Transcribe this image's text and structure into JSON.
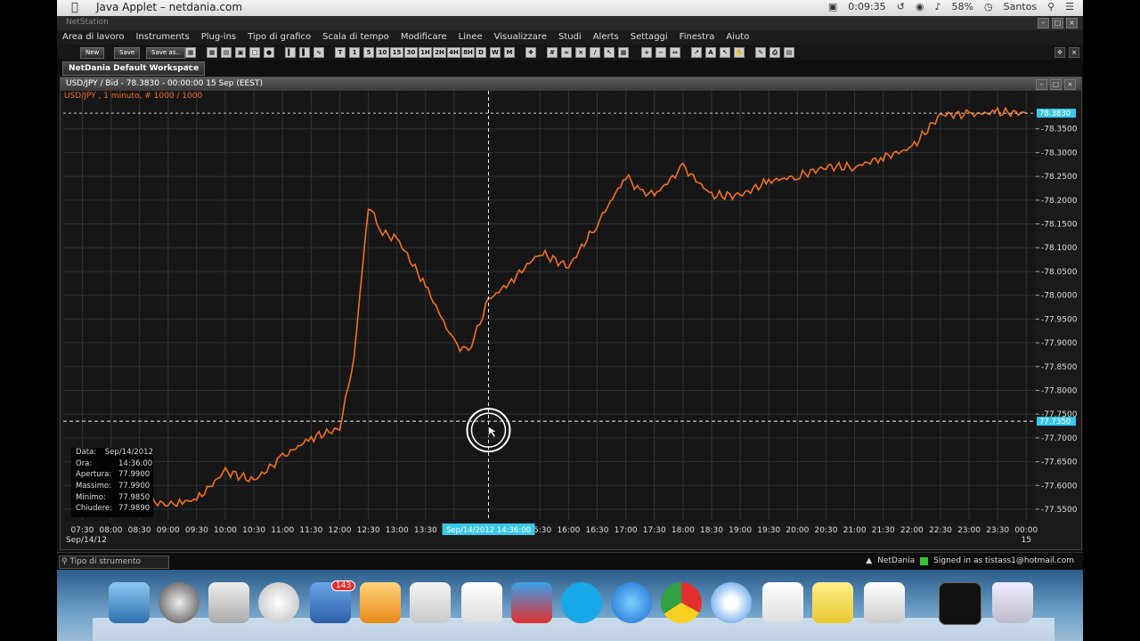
{
  "mac_menubar": {
    "app_title": "Java Applet – netdania.com",
    "clock": "0:09:35",
    "battery": "58%",
    "user": "Santos"
  },
  "netstation": {
    "title": "NetStation"
  },
  "app_menu": {
    "items": [
      "Area di lavoro",
      "Instruments",
      "Plug-ins",
      "Tipo di grafico",
      "Scala di tempo",
      "Modificare",
      "Linee",
      "Visualizzare",
      "Studi",
      "Alerts",
      "Settaggi",
      "Finestra",
      "Aiuto"
    ]
  },
  "toolbar": {
    "new_label": "New",
    "save_label": "Save",
    "save_as_label": "Save as..",
    "timeframes": [
      "T",
      "1",
      "5",
      "10",
      "15",
      "30",
      "1H",
      "2H",
      "4H",
      "8H",
      "D",
      "W",
      "M"
    ]
  },
  "workspace": {
    "tab_label": "NetDania Default Workspace",
    "close": "×"
  },
  "chart_window": {
    "title": "USD/JPY / Bid - 78.3830 - 00:00:00  15 Sep (EEST)",
    "legend": "USD/JPY , 1 minuto, # 1000 / 1000"
  },
  "info": {
    "rows": [
      {
        "k": "Data:",
        "v": "Sep/14/2012"
      },
      {
        "k": "Ora:",
        "v": "14:36:00"
      },
      {
        "k": "Apertura:",
        "v": "77.9900"
      },
      {
        "k": "Massimo:",
        "v": "77.9900"
      },
      {
        "k": "Minimo:",
        "v": "77.9850"
      },
      {
        "k": "Chiudere:",
        "v": "77.9890"
      }
    ]
  },
  "status_bar": {
    "tool_placeholder": "Tipo di strumento",
    "provider": "NetDania",
    "signed_in": "Signed in as tistass1@hotmail.com"
  },
  "dock": {
    "mail_badge": "143"
  },
  "colors": {
    "series": "#f07020",
    "price_tag": "#38c8e8",
    "grid": "#333333"
  },
  "chart_data": {
    "type": "line",
    "series": [
      {
        "x": [
          "07:30",
          "08:00",
          "08:30",
          "09:00",
          "09:15",
          "09:30",
          "10:00",
          "10:30",
          "11:00",
          "11:30",
          "12:00",
          "12:15",
          "12:30",
          "12:45",
          "13:00",
          "13:30",
          "14:00",
          "14:15",
          "14:36",
          "15:00",
          "15:30",
          "16:00",
          "16:30",
          "17:00",
          "17:15",
          "17:30",
          "18:00",
          "18:30",
          "19:00",
          "19:30",
          "20:00",
          "20:30",
          "21:00",
          "21:30",
          "22:00",
          "22:30",
          "23:00",
          "23:30",
          "00:00"
        ],
        "y": [
          77.61,
          77.6,
          77.57,
          77.56,
          77.565,
          77.57,
          77.63,
          77.61,
          77.66,
          77.7,
          77.72,
          77.87,
          78.19,
          78.13,
          78.12,
          78.02,
          77.9,
          77.88,
          77.99,
          78.03,
          78.09,
          78.06,
          78.15,
          78.25,
          78.22,
          78.21,
          78.27,
          78.21,
          78.21,
          78.24,
          78.25,
          78.27,
          78.27,
          78.29,
          78.31,
          78.38,
          78.38,
          78.385,
          78.383
        ]
      }
    ],
    "y_ticks": [
      "78.3500",
      "78.3000",
      "78.2500",
      "78.2000",
      "78.1500",
      "78.1000",
      "78.0500",
      "78.0000",
      "77.9500",
      "77.9000",
      "77.8500",
      "77.8000",
      "77.7500",
      "77.7000",
      "77.6500",
      "77.6000",
      "77.5500"
    ],
    "x_ticks": [
      "07:30",
      "08:00",
      "08:30",
      "09:00",
      "09:30",
      "10:00",
      "10:30",
      "11:00",
      "11:30",
      "12:00",
      "12:30",
      "13:00",
      "13:30",
      "14:00",
      "",
      "15:30",
      "16:00",
      "16:30",
      "17:00",
      "17:30",
      "18:00",
      "18:30",
      "19:00",
      "19:30",
      "20:00",
      "20:30",
      "21:00",
      "21:30",
      "22:00",
      "22:30",
      "23:00",
      "23:30",
      "00:00"
    ],
    "x_sub_left": "Sep/14/12",
    "x_sub_right": "15",
    "ylim": [
      77.5275,
      78.4075
    ],
    "last_price_label": "78.3830",
    "crosshair_price_label": "77.7350",
    "crosshair_time_label": "Sep/14/2012 14:36:00",
    "crosshair_x": "14:36",
    "crosshair_y": 77.735,
    "grid": true
  }
}
